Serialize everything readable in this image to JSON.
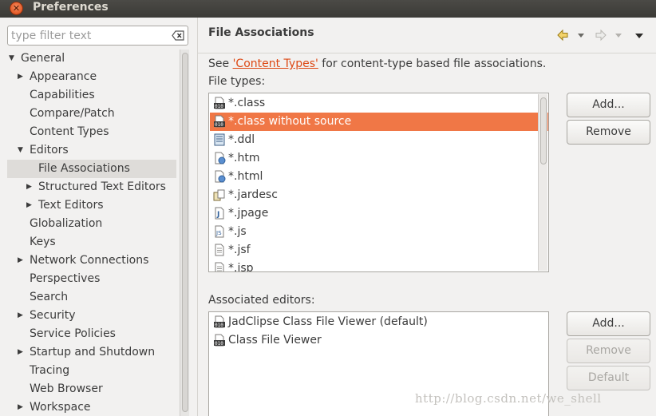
{
  "window": {
    "title": "Preferences",
    "close_glyph": "✕"
  },
  "filter": {
    "placeholder": "type filter text"
  },
  "tree": [
    {
      "label": "General",
      "expanded": true,
      "level": 0
    },
    {
      "label": "Appearance",
      "expanded": false,
      "level": 1
    },
    {
      "label": "Capabilities",
      "level": 1
    },
    {
      "label": "Compare/Patch",
      "level": 1
    },
    {
      "label": "Content Types",
      "level": 1
    },
    {
      "label": "Editors",
      "expanded": true,
      "level": 1
    },
    {
      "label": "File Associations",
      "level": 2,
      "selected": true
    },
    {
      "label": "Structured Text Editors",
      "expanded": false,
      "level": 2
    },
    {
      "label": "Text Editors",
      "expanded": false,
      "level": 2
    },
    {
      "label": "Globalization",
      "level": 1
    },
    {
      "label": "Keys",
      "level": 1
    },
    {
      "label": "Network Connections",
      "expanded": false,
      "level": 1
    },
    {
      "label": "Perspectives",
      "level": 1
    },
    {
      "label": "Search",
      "level": 1
    },
    {
      "label": "Security",
      "expanded": false,
      "level": 1
    },
    {
      "label": "Service Policies",
      "level": 1
    },
    {
      "label": "Startup and Shutdown",
      "expanded": false,
      "level": 1
    },
    {
      "label": "Tracing",
      "level": 1
    },
    {
      "label": "Web Browser",
      "level": 1
    },
    {
      "label": "Workspace",
      "expanded": false,
      "level": 1
    }
  ],
  "page": {
    "title": "File Associations",
    "desc_prefix": "See ",
    "desc_link": "'Content Types'",
    "desc_suffix": " for content-type based file associations.",
    "file_types_label": "File types:",
    "assoc_label": "Associated editors:"
  },
  "file_types": [
    {
      "label": "*.class",
      "icon": "class-file-icon"
    },
    {
      "label": "*.class without source",
      "icon": "class-file-icon",
      "selected": true
    },
    {
      "label": "*.ddl",
      "icon": "ddl-file-icon"
    },
    {
      "label": "*.htm",
      "icon": "html-file-icon"
    },
    {
      "label": "*.html",
      "icon": "html-file-icon"
    },
    {
      "label": "*.jardesc",
      "icon": "jardesc-file-icon"
    },
    {
      "label": "*.jpage",
      "icon": "jpage-file-icon"
    },
    {
      "label": "*.js",
      "icon": "js-file-icon"
    },
    {
      "label": "*.jsf",
      "icon": "text-file-icon"
    },
    {
      "label": "*.jsp",
      "icon": "text-file-icon"
    }
  ],
  "editors": [
    {
      "label": "JadClipse Class File Viewer (default)",
      "icon": "class-file-icon"
    },
    {
      "label": "Class File Viewer",
      "icon": "class-file-icon"
    }
  ],
  "buttons": {
    "add_types": "Add...",
    "remove_types": "Remove",
    "add_editors": "Add...",
    "remove_editors": "Remove",
    "default_editors": "Default"
  },
  "colors": {
    "selection": "#f07746",
    "link": "#dd4814",
    "titlebar": "#3c3b37"
  },
  "watermark": "http://blog.csdn.net/we_shell"
}
